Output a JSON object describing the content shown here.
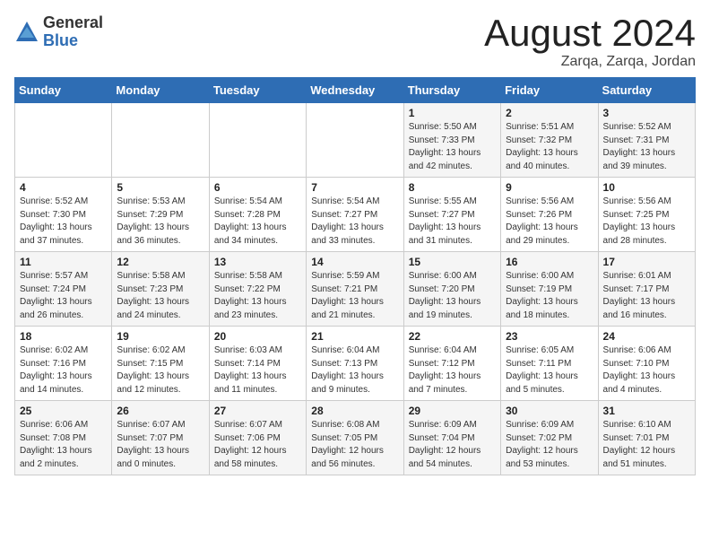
{
  "header": {
    "logo_general": "General",
    "logo_blue": "Blue",
    "title": "August 2024",
    "location": "Zarqa, Zarqa, Jordan"
  },
  "weekdays": [
    "Sunday",
    "Monday",
    "Tuesday",
    "Wednesday",
    "Thursday",
    "Friday",
    "Saturday"
  ],
  "weeks": [
    [
      {
        "day": "",
        "info": ""
      },
      {
        "day": "",
        "info": ""
      },
      {
        "day": "",
        "info": ""
      },
      {
        "day": "",
        "info": ""
      },
      {
        "day": "1",
        "info": "Sunrise: 5:50 AM\nSunset: 7:33 PM\nDaylight: 13 hours\nand 42 minutes."
      },
      {
        "day": "2",
        "info": "Sunrise: 5:51 AM\nSunset: 7:32 PM\nDaylight: 13 hours\nand 40 minutes."
      },
      {
        "day": "3",
        "info": "Sunrise: 5:52 AM\nSunset: 7:31 PM\nDaylight: 13 hours\nand 39 minutes."
      }
    ],
    [
      {
        "day": "4",
        "info": "Sunrise: 5:52 AM\nSunset: 7:30 PM\nDaylight: 13 hours\nand 37 minutes."
      },
      {
        "day": "5",
        "info": "Sunrise: 5:53 AM\nSunset: 7:29 PM\nDaylight: 13 hours\nand 36 minutes."
      },
      {
        "day": "6",
        "info": "Sunrise: 5:54 AM\nSunset: 7:28 PM\nDaylight: 13 hours\nand 34 minutes."
      },
      {
        "day": "7",
        "info": "Sunrise: 5:54 AM\nSunset: 7:27 PM\nDaylight: 13 hours\nand 33 minutes."
      },
      {
        "day": "8",
        "info": "Sunrise: 5:55 AM\nSunset: 7:27 PM\nDaylight: 13 hours\nand 31 minutes."
      },
      {
        "day": "9",
        "info": "Sunrise: 5:56 AM\nSunset: 7:26 PM\nDaylight: 13 hours\nand 29 minutes."
      },
      {
        "day": "10",
        "info": "Sunrise: 5:56 AM\nSunset: 7:25 PM\nDaylight: 13 hours\nand 28 minutes."
      }
    ],
    [
      {
        "day": "11",
        "info": "Sunrise: 5:57 AM\nSunset: 7:24 PM\nDaylight: 13 hours\nand 26 minutes."
      },
      {
        "day": "12",
        "info": "Sunrise: 5:58 AM\nSunset: 7:23 PM\nDaylight: 13 hours\nand 24 minutes."
      },
      {
        "day": "13",
        "info": "Sunrise: 5:58 AM\nSunset: 7:22 PM\nDaylight: 13 hours\nand 23 minutes."
      },
      {
        "day": "14",
        "info": "Sunrise: 5:59 AM\nSunset: 7:21 PM\nDaylight: 13 hours\nand 21 minutes."
      },
      {
        "day": "15",
        "info": "Sunrise: 6:00 AM\nSunset: 7:20 PM\nDaylight: 13 hours\nand 19 minutes."
      },
      {
        "day": "16",
        "info": "Sunrise: 6:00 AM\nSunset: 7:19 PM\nDaylight: 13 hours\nand 18 minutes."
      },
      {
        "day": "17",
        "info": "Sunrise: 6:01 AM\nSunset: 7:17 PM\nDaylight: 13 hours\nand 16 minutes."
      }
    ],
    [
      {
        "day": "18",
        "info": "Sunrise: 6:02 AM\nSunset: 7:16 PM\nDaylight: 13 hours\nand 14 minutes."
      },
      {
        "day": "19",
        "info": "Sunrise: 6:02 AM\nSunset: 7:15 PM\nDaylight: 13 hours\nand 12 minutes."
      },
      {
        "day": "20",
        "info": "Sunrise: 6:03 AM\nSunset: 7:14 PM\nDaylight: 13 hours\nand 11 minutes."
      },
      {
        "day": "21",
        "info": "Sunrise: 6:04 AM\nSunset: 7:13 PM\nDaylight: 13 hours\nand 9 minutes."
      },
      {
        "day": "22",
        "info": "Sunrise: 6:04 AM\nSunset: 7:12 PM\nDaylight: 13 hours\nand 7 minutes."
      },
      {
        "day": "23",
        "info": "Sunrise: 6:05 AM\nSunset: 7:11 PM\nDaylight: 13 hours\nand 5 minutes."
      },
      {
        "day": "24",
        "info": "Sunrise: 6:06 AM\nSunset: 7:10 PM\nDaylight: 13 hours\nand 4 minutes."
      }
    ],
    [
      {
        "day": "25",
        "info": "Sunrise: 6:06 AM\nSunset: 7:08 PM\nDaylight: 13 hours\nand 2 minutes."
      },
      {
        "day": "26",
        "info": "Sunrise: 6:07 AM\nSunset: 7:07 PM\nDaylight: 13 hours\nand 0 minutes."
      },
      {
        "day": "27",
        "info": "Sunrise: 6:07 AM\nSunset: 7:06 PM\nDaylight: 12 hours\nand 58 minutes."
      },
      {
        "day": "28",
        "info": "Sunrise: 6:08 AM\nSunset: 7:05 PM\nDaylight: 12 hours\nand 56 minutes."
      },
      {
        "day": "29",
        "info": "Sunrise: 6:09 AM\nSunset: 7:04 PM\nDaylight: 12 hours\nand 54 minutes."
      },
      {
        "day": "30",
        "info": "Sunrise: 6:09 AM\nSunset: 7:02 PM\nDaylight: 12 hours\nand 53 minutes."
      },
      {
        "day": "31",
        "info": "Sunrise: 6:10 AM\nSunset: 7:01 PM\nDaylight: 12 hours\nand 51 minutes."
      }
    ]
  ]
}
